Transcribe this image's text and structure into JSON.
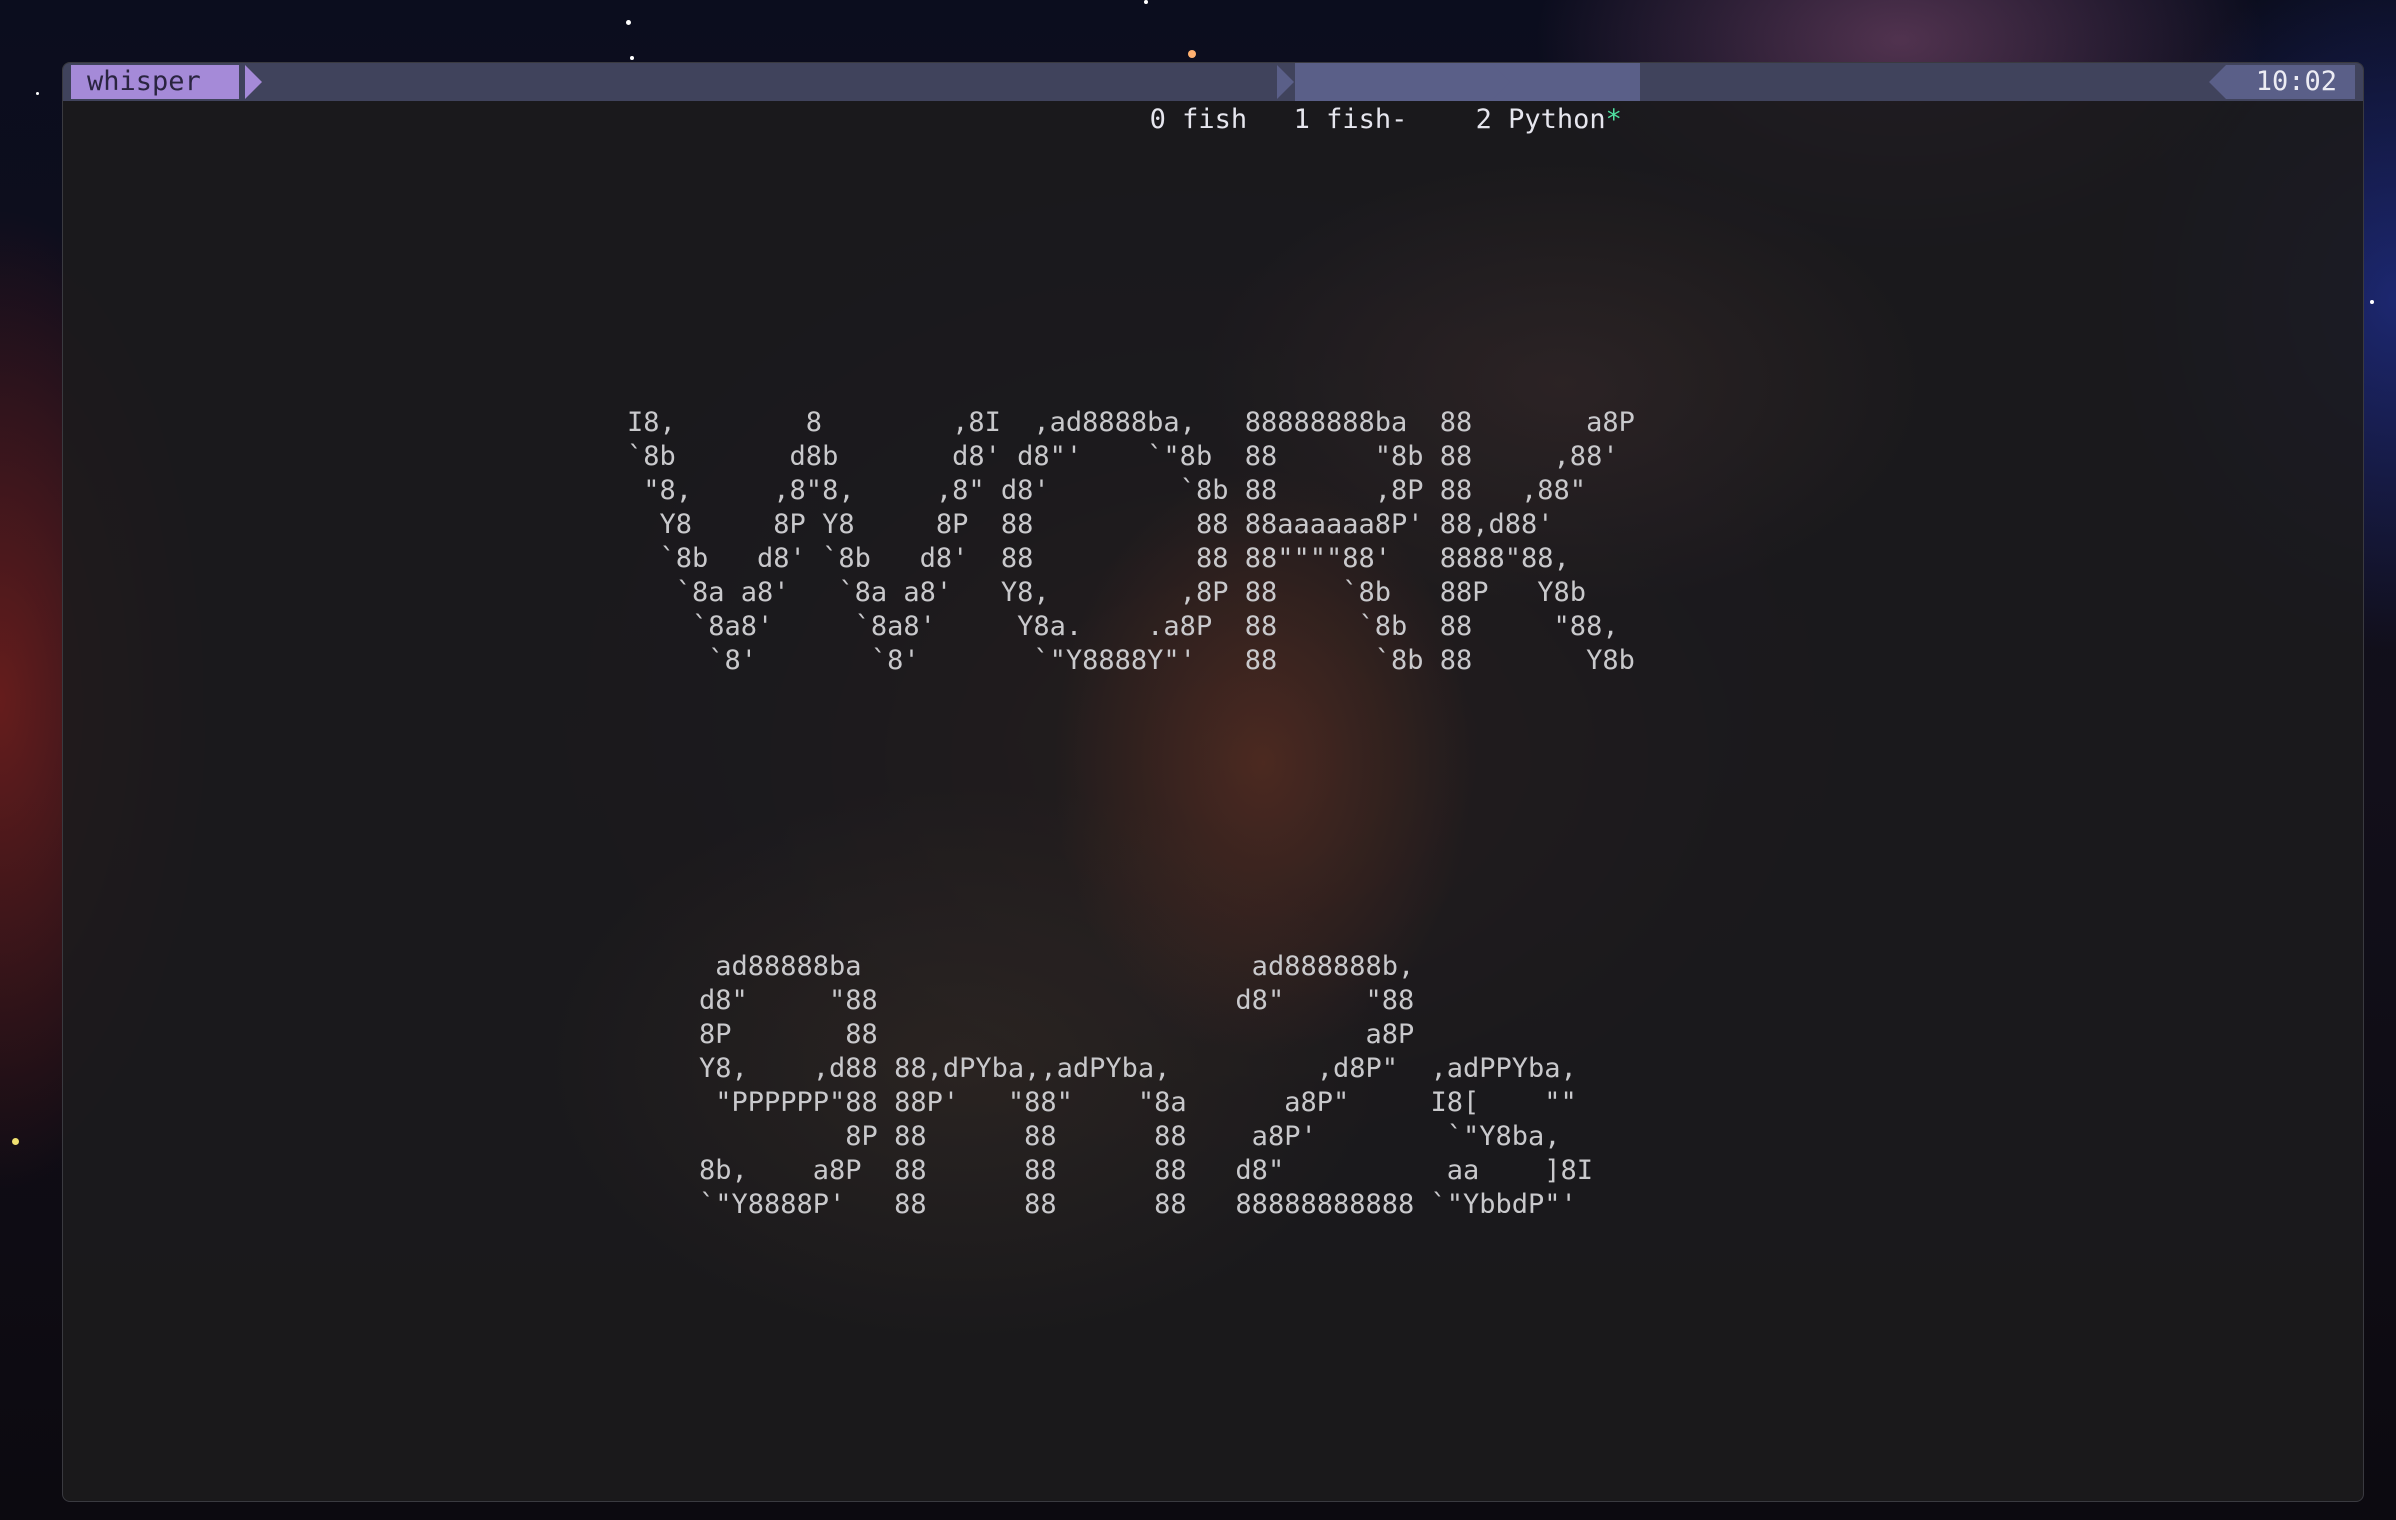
{
  "status_bar": {
    "session_name": "whisper",
    "windows": [
      {
        "label": "0 fish",
        "active": false
      },
      {
        "label": "1 fish-",
        "active": false
      },
      {
        "label": "2 Python",
        "flag": "*",
        "active": true
      }
    ],
    "clock": "10:02"
  },
  "terminal_output": {
    "ascii_top": [
      "I8,        8        ,8I  ,ad8888ba,   88888888ba  88       a8P",
      "`8b       d8b       d8' d8\"'    `\"8b  88      \"8b 88     ,88'",
      " \"8,     ,8\"8,     ,8\" d8'        `8b 88      ,8P 88   ,88\"",
      "  Y8     8P Y8     8P  88          88 88aaaaaa8P' 88,d88'",
      "  `8b   d8' `8b   d8'  88          88 88\"\"\"\"88'   8888\"88,",
      "   `8a a8'   `8a a8'   Y8,        ,8P 88    `8b   88P   Y8b",
      "    `8a8'     `8a8'     Y8a.    .a8P  88     `8b  88     \"88,",
      "     `8'       `8'       `\"Y8888Y\"'   88      `8b 88       Y8b"
    ],
    "ascii_bottom": [
      " ad88888ba                        ad888888b,",
      "d8\"     \"88                      d8\"     \"88",
      "8P       88                              a8P",
      "Y8,    ,d88 88,dPYba,,adPYba,         ,d8P\"  ,adPPYba,",
      " \"PPPPPP\"88 88P'   \"88\"    \"8a      a8P\"     I8[    \"\"",
      "         8P 88      88      88    a8P'        `\"Y8ba,",
      "8b,    a8P  88      88      88   d8\"          aa    ]8I",
      "`\"Y8888P'   88      88      88   88888888888 `\"YbbdP\"'"
    ]
  },
  "colors": {
    "status_bar_bg": "#40435c",
    "session_accent": "#a58ad8",
    "active_window_bg": "#5a5f88",
    "active_flag": "#4fe0a0",
    "terminal_text": "#c9c9cc"
  }
}
